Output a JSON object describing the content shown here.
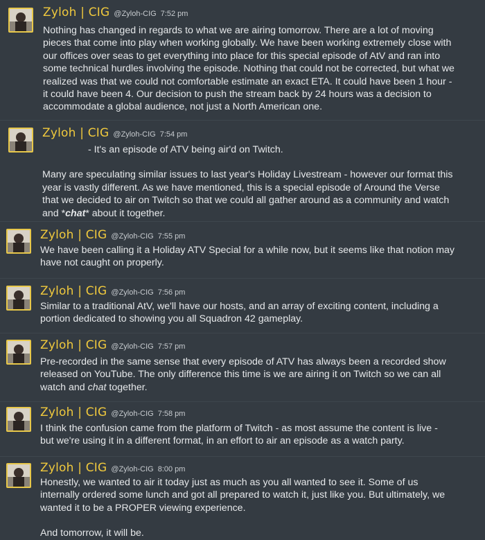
{
  "author": {
    "name": "Zyloh | CIG",
    "handle": "@Zyloh-CIG"
  },
  "colors": {
    "background": "#343b42",
    "name": "#f0c93d",
    "avatar_border": "#e8c84a",
    "text": "#e6e8ea"
  },
  "messages": [
    {
      "time": "7:52 pm",
      "lines": [
        "Nothing has changed in regards to what we are airing tomorrow. There are a lot of moving",
        "pieces that come into play when working globally. We have been working extremely close with",
        "our offices over seas to get everything into place for this special episode of AtV and ran into",
        "some technical hurdles involving the episode. Nothing that could not be corrected, but what we",
        "realized was that we could not comfortable estimate an exact ETA. It could have been 1 hour -",
        "it could have been 4. Our decision to push the stream back by 24 hours was a decision to",
        "accommodate a global audience, not just a North American one."
      ]
    },
    {
      "time": "7:54 pm",
      "lines": [
        "- It's an episode of ATV being air'd on Twitch.",
        "Many are speculating similar issues to last year's Holiday Livestream - however our format this",
        "year is vastly different. As we have mentioned, this is a special episode of Around the Verse",
        "that we decided to air on Twitch so that we could all gather around as a community and watch",
        "and *",
        "chat",
        "* about it together."
      ]
    },
    {
      "time": "7:55 pm",
      "lines": [
        "We have been calling it a Holiday ATV Special for a while now, but it seems like that notion may",
        "have not caught on properly."
      ]
    },
    {
      "time": "7:56 pm",
      "lines": [
        "Similar to a traditional AtV, we'll have our hosts, and an array of exciting content, including a",
        "portion dedicated to showing you all Squadron 42 gameplay."
      ]
    },
    {
      "time": "7:57 pm",
      "lines": [
        "Pre-recorded in the same sense that every episode of ATV has always been a recorded show",
        "released on YouTube. The only difference this time is we are airing it on Twitch so we can all",
        "watch and ",
        "chat",
        " together."
      ]
    },
    {
      "time": "7:58 pm",
      "lines": [
        "I think the confusion came from the platform of Twitch - as most assume the content is live -",
        "but we're using it in a different format, in an effort to air an episode as a watch party."
      ]
    },
    {
      "time": "8:00 pm",
      "lines": [
        "Honestly, we wanted to air it today just as much as you all wanted to see it. Some of us",
        "internally ordered some lunch and got all prepared to watch it, just like you. But ultimately, we",
        "wanted it to be a PROPER viewing experience.",
        "And tomorrow, it will be."
      ]
    }
  ]
}
